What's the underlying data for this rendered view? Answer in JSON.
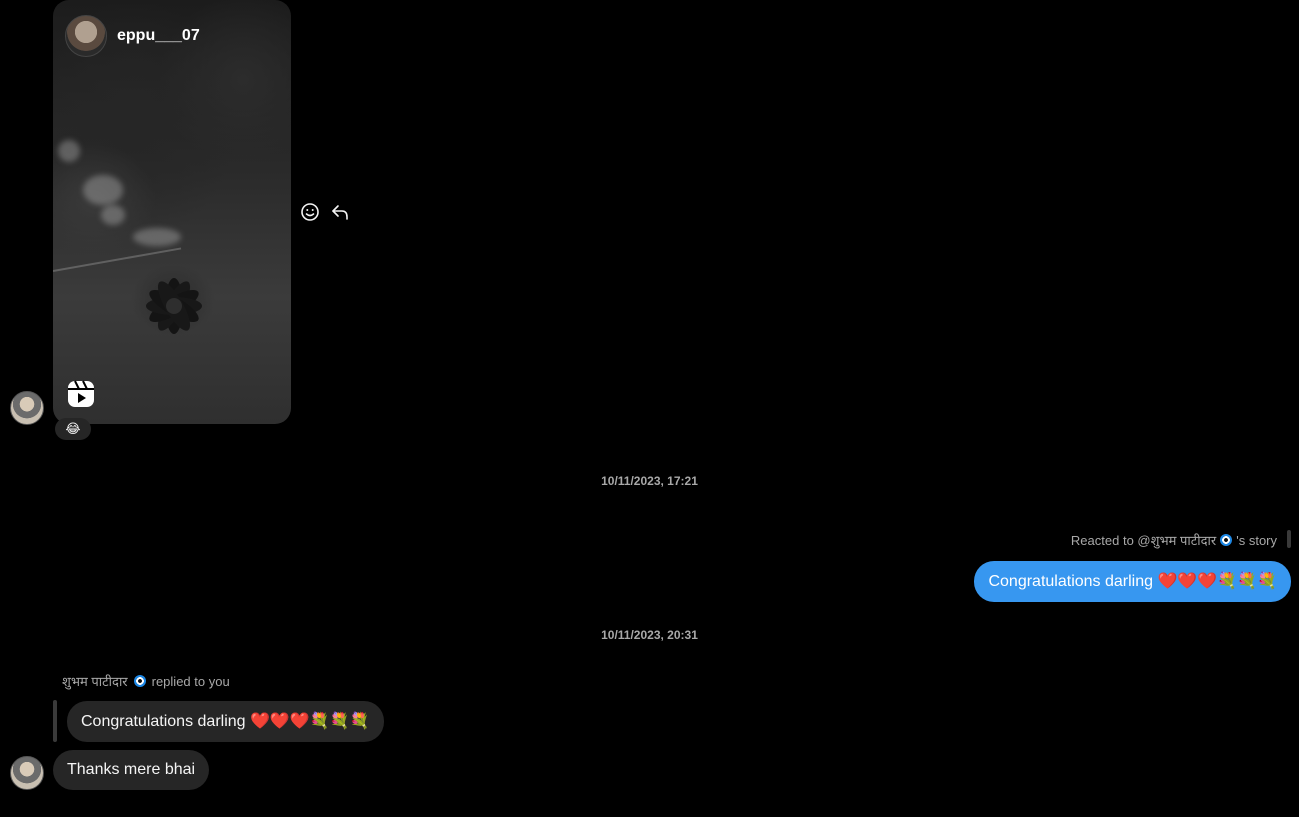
{
  "reel": {
    "username": "eppu___07",
    "reaction_emoji": "😂"
  },
  "timestamps": {
    "first": "10/11/2023, 17:21",
    "second": "10/11/2023, 20:31"
  },
  "outgoing": {
    "reacted_prefix": "Reacted to @शुभम पाटीदार",
    "reacted_suffix": "'s story",
    "message_text": "Congratulations darling",
    "message_emojis": "❤️❤️❤️💐💐💐"
  },
  "incoming": {
    "reply_sender": "शुभम पाटीदार",
    "reply_label": "replied to you",
    "quoted_text": "Congratulations darling",
    "quoted_emojis": "❤️❤️❤️💐💐💐",
    "message_text": "Thanks mere bhai"
  },
  "colors": {
    "background": "#000000",
    "outgoing_bubble": "#3797f0",
    "incoming_bubble": "#262626",
    "muted_text": "#a8a8a8"
  },
  "icons": {
    "react": "smiley-icon",
    "reply": "reply-arrow-icon",
    "reel": "reels-icon"
  }
}
